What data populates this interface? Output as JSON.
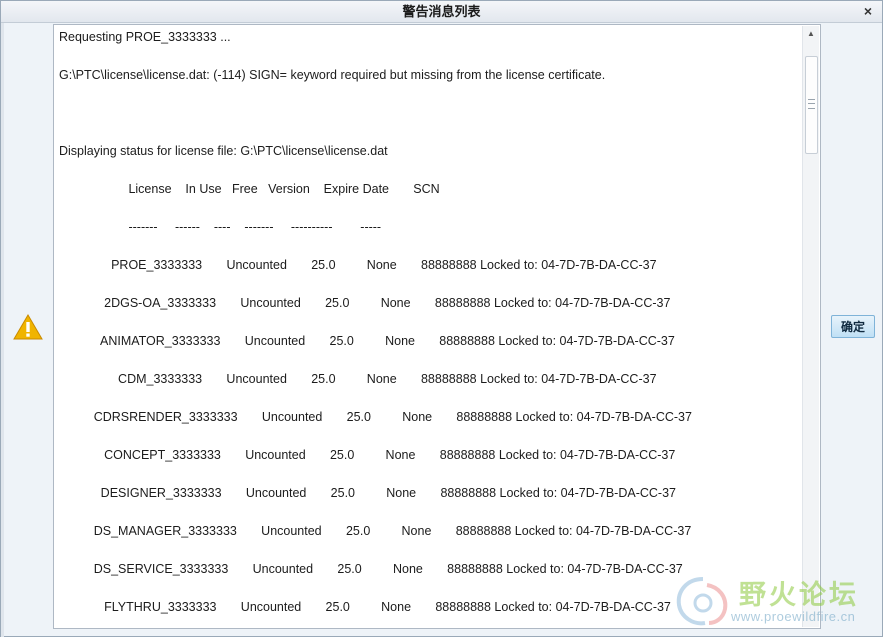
{
  "window": {
    "title": "警告消息列表",
    "close_label": "×"
  },
  "icons": {
    "warning": "warning-triangle-icon",
    "close": "close-icon"
  },
  "colors": {
    "warning_fill": "#f0b400",
    "ok_button_border": "#7fb3d8"
  },
  "messages": [
    "Requesting PROE_3333333 ...",
    "",
    "G:\\PTC\\license\\license.dat: (-114) SIGN= keyword required but missing from the license certificate.",
    "",
    "",
    "",
    "Displaying status for license file: G:\\PTC\\license\\license.dat",
    "",
    "                    License    In Use   Free   Version    Expire Date       SCN",
    "",
    "                    -------     ------    ----    -------     ----------        -----",
    "",
    "               PROE_3333333       Uncounted       25.0         None       88888888 Locked to: 04-7D-7B-DA-CC-37",
    "",
    "             2DGS-OA_3333333       Uncounted       25.0         None       88888888 Locked to: 04-7D-7B-DA-CC-37",
    "",
    "            ANIMATOR_3333333       Uncounted       25.0         None       88888888 Locked to: 04-7D-7B-DA-CC-37",
    "",
    "                 CDM_3333333       Uncounted       25.0         None       88888888 Locked to: 04-7D-7B-DA-CC-37",
    "",
    "          CDRSRENDER_3333333       Uncounted       25.0         None       88888888 Locked to: 04-7D-7B-DA-CC-37",
    "",
    "             CONCEPT_3333333       Uncounted       25.0         None       88888888 Locked to: 04-7D-7B-DA-CC-37",
    "",
    "            DESIGNER_3333333       Uncounted       25.0         None       88888888 Locked to: 04-7D-7B-DA-CC-37",
    "",
    "          DS_MANAGER_3333333       Uncounted       25.0         None       88888888 Locked to: 04-7D-7B-DA-CC-37",
    "",
    "          DS_SERVICE_3333333       Uncounted       25.0         None       88888888 Locked to: 04-7D-7B-DA-CC-37",
    "",
    "             FLYTHRU_3333333       Uncounted       25.0         None       88888888 Locked to: 04-7D-7B-DA-CC-37"
  ],
  "buttons": {
    "ok_label": "确定"
  },
  "watermark": {
    "title": "野火论坛",
    "url": "www.proewildfire.cn"
  }
}
